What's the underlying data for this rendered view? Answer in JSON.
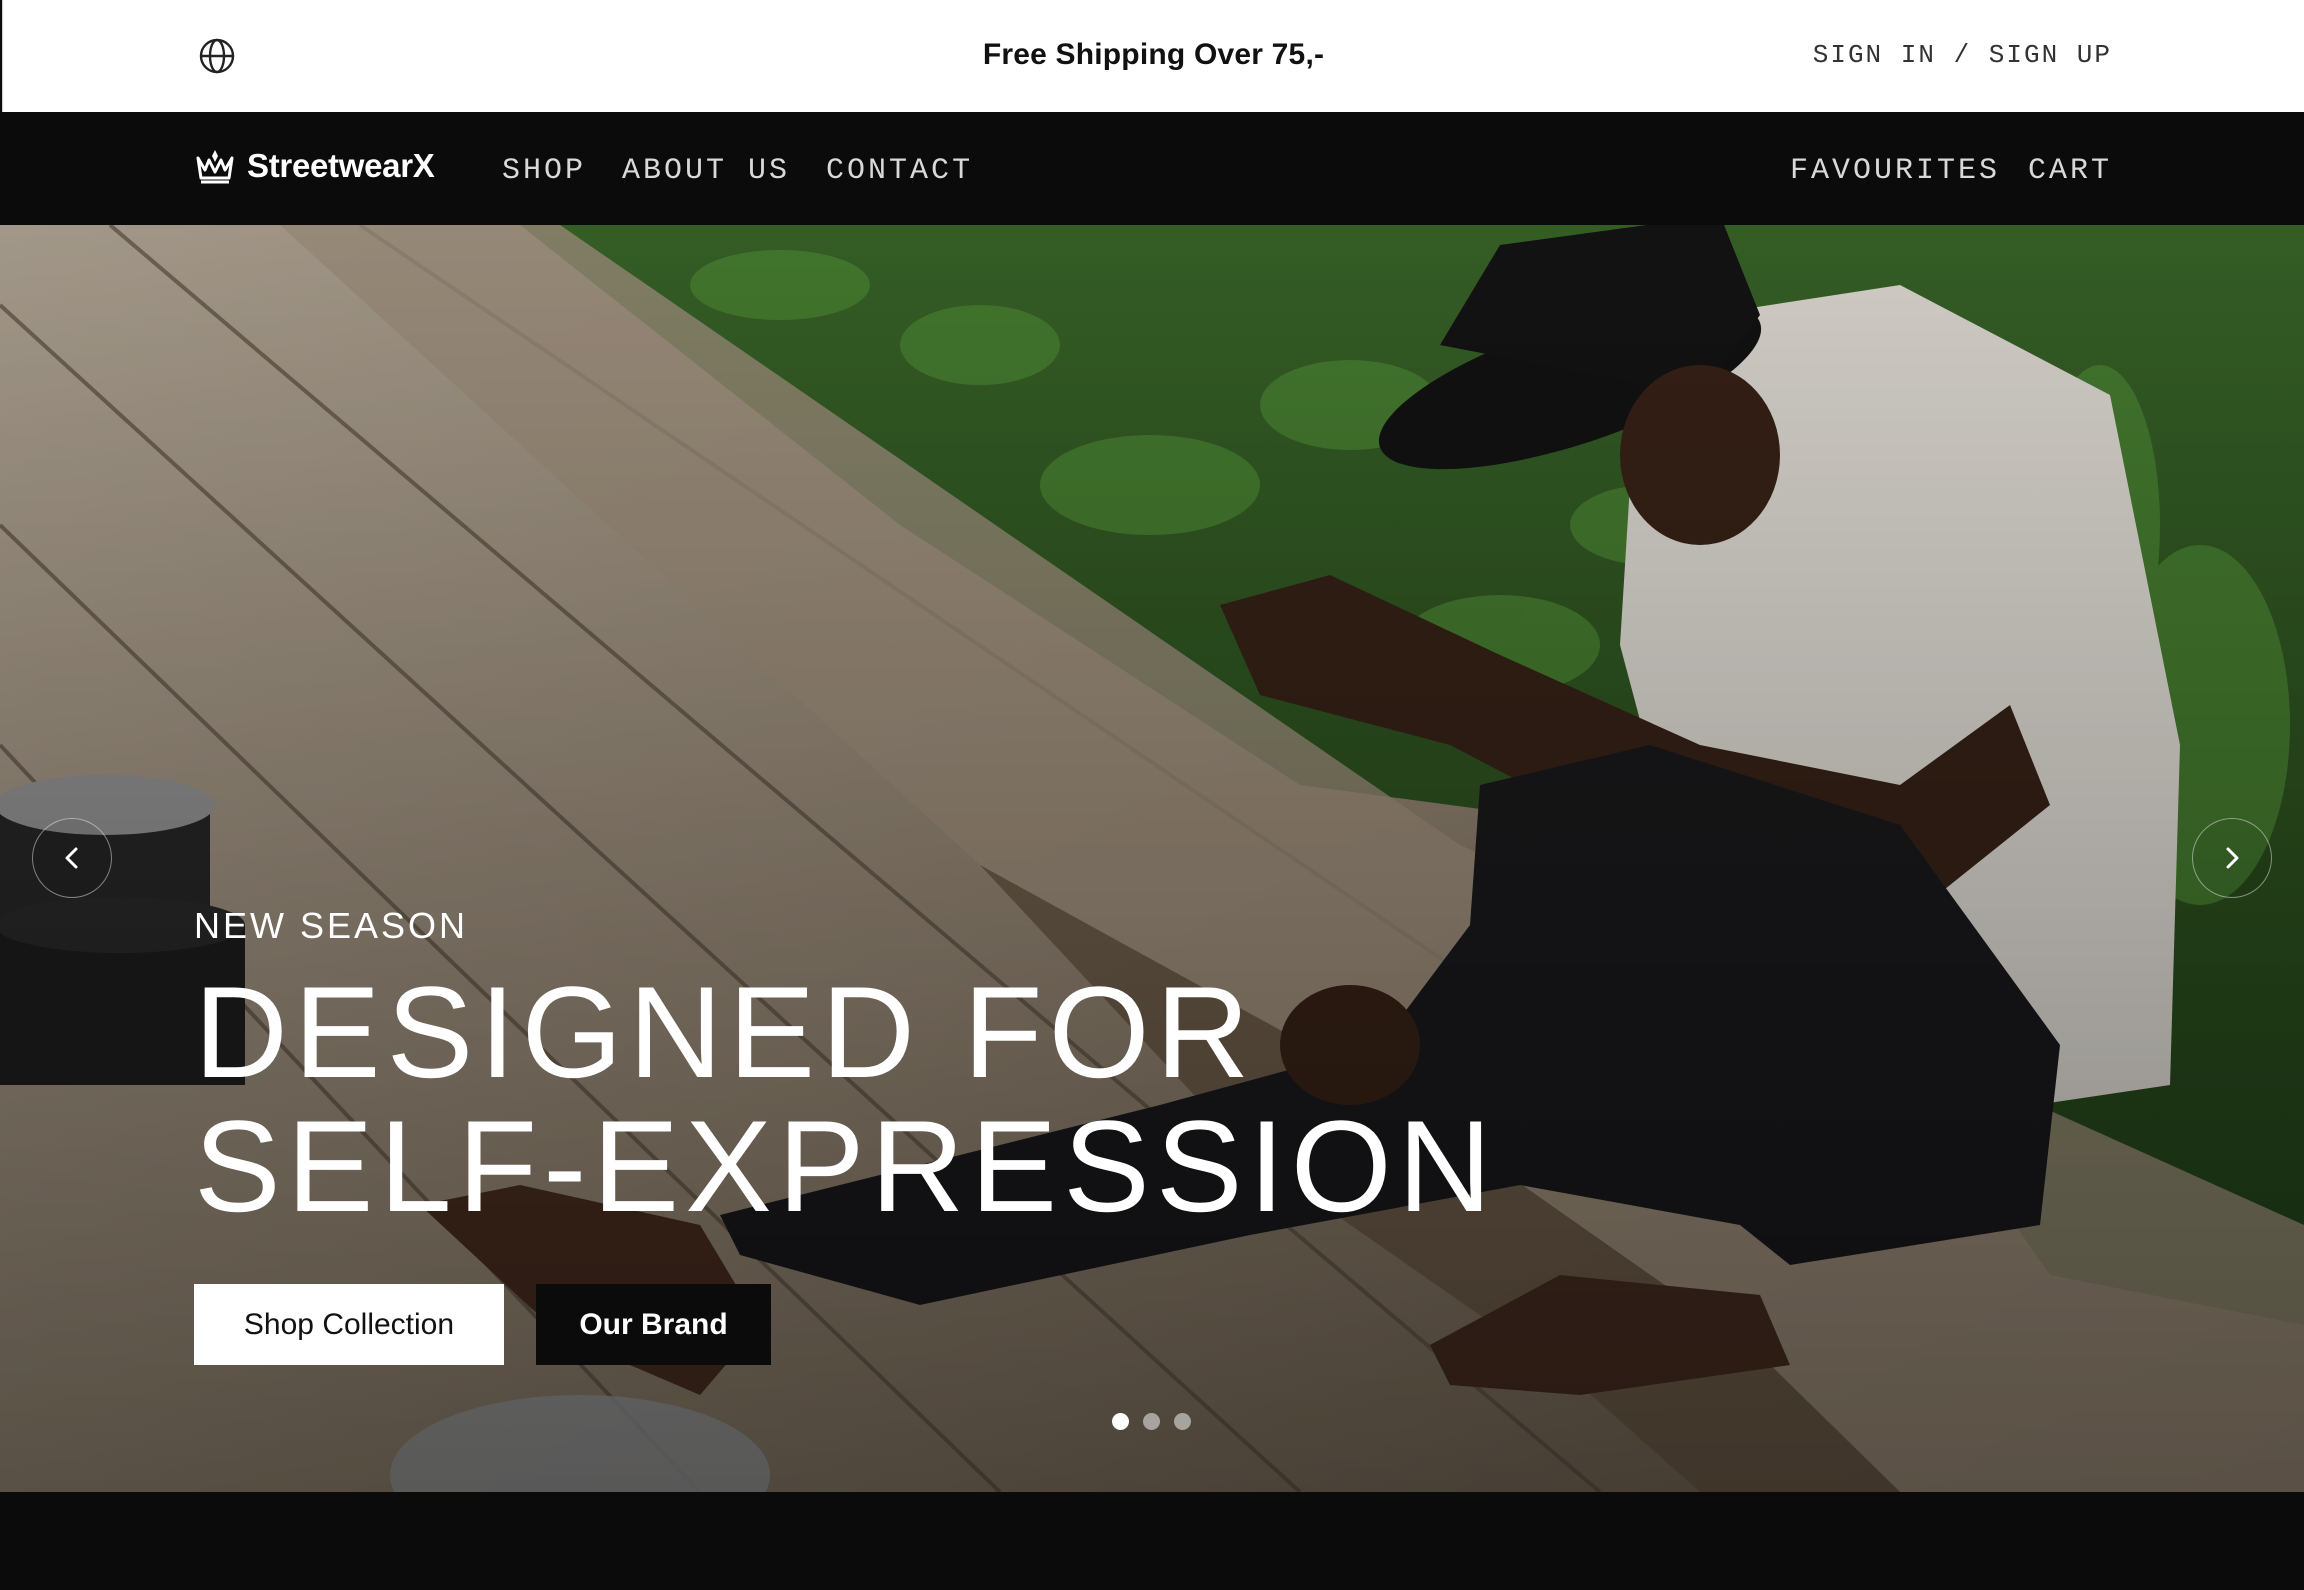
{
  "announcement": {
    "globe_icon": "globe-icon",
    "text": "Free Shipping Over 75,-",
    "auth_link": "SIGN IN / SIGN UP"
  },
  "nav": {
    "logo_icon": "crown-icon",
    "brand": "StreetwearX",
    "left_links": [
      "SHOP",
      "ABOUT US",
      "CONTACT"
    ],
    "right_links": [
      "FAVOURITES",
      "CART"
    ]
  },
  "hero": {
    "eyebrow": "NEW SEASON",
    "headline_line1": "DESIGNED FOR",
    "headline_line2": "SELF-EXPRESSION",
    "primary_cta": "Shop Collection",
    "secondary_cta": "Our Brand",
    "prev_icon": "chevron-left-icon",
    "next_icon": "chevron-right-icon",
    "slide_count": 3,
    "active_slide": 1
  },
  "colors": {
    "nav_bg": "#0b0b0b",
    "topbar_bg": "#ffffff",
    "text_light": "#ffffff",
    "nav_link": "#d9d9d9"
  }
}
